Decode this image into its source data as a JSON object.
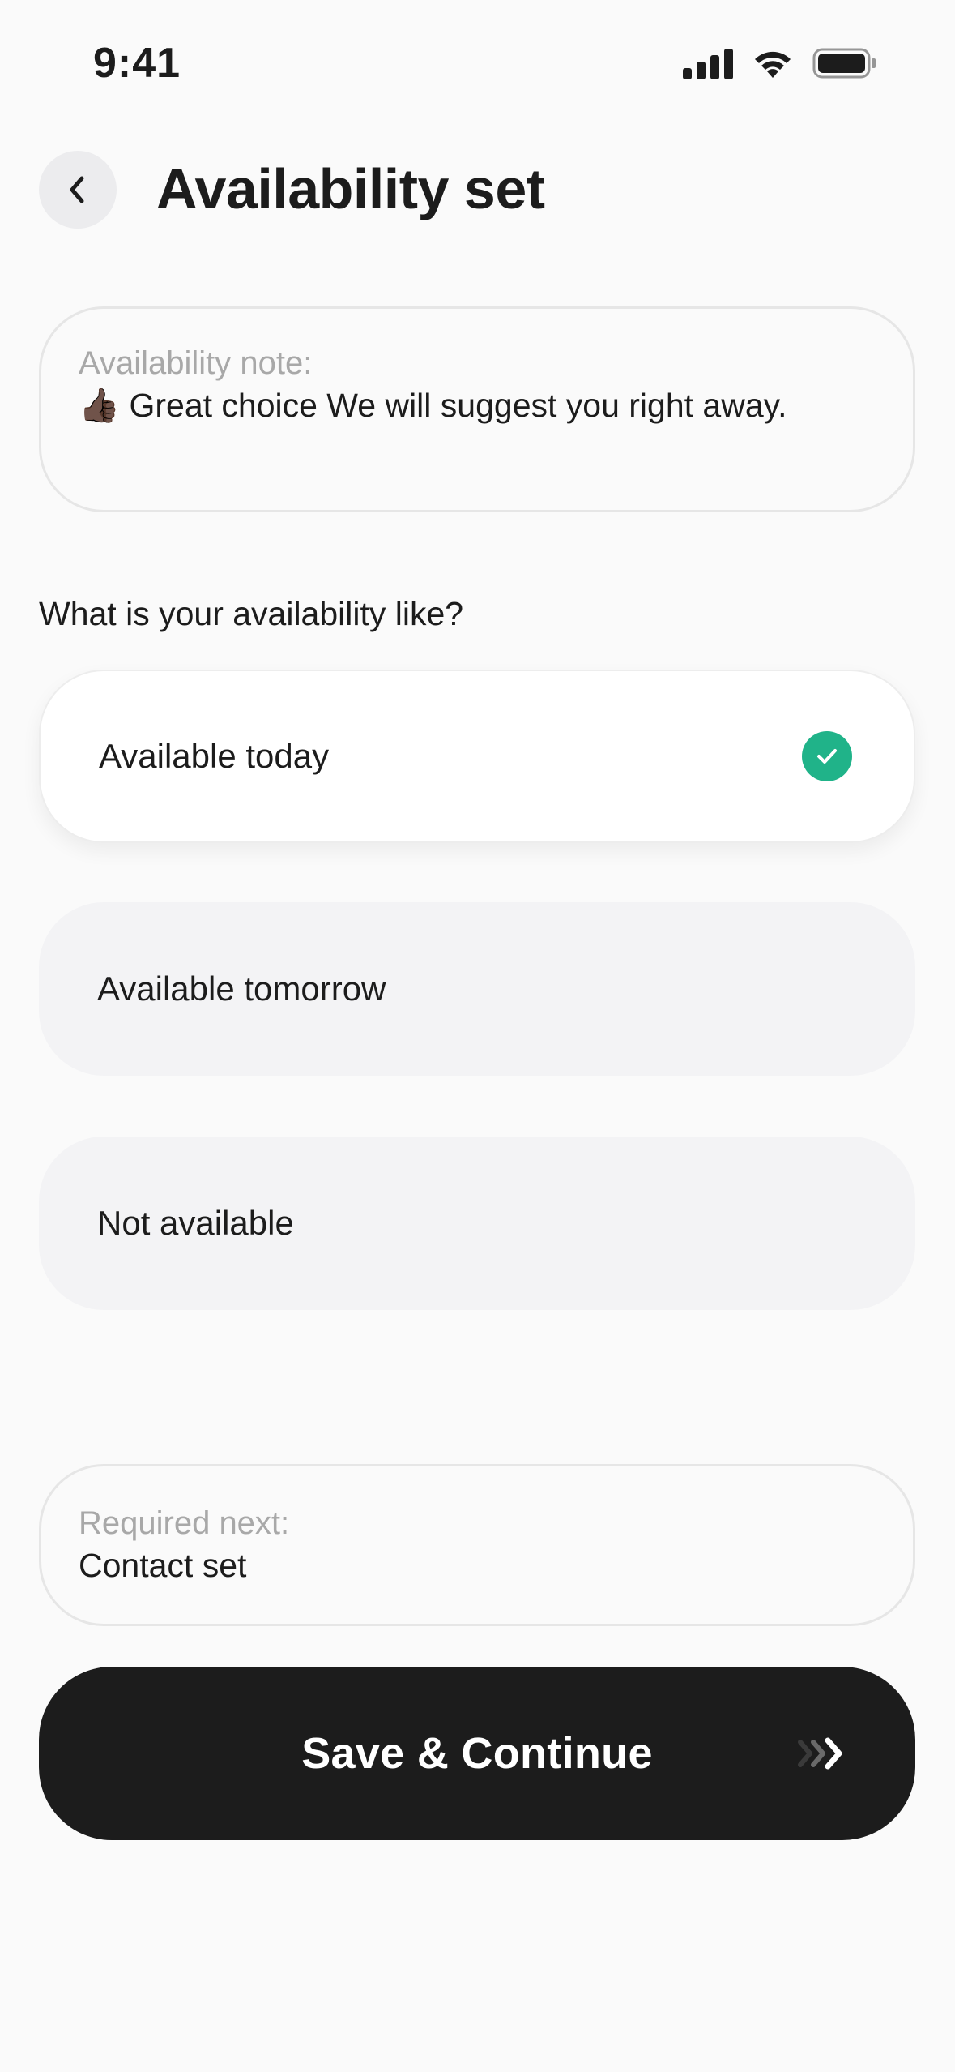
{
  "status_bar": {
    "time": "9:41",
    "icons": [
      "cellular-signal-icon",
      "wifi-icon",
      "battery-icon"
    ]
  },
  "header": {
    "back_icon": "chevron-left-icon",
    "title": "Availability set"
  },
  "note": {
    "label": "Availability note:",
    "emoji": "👍🏿",
    "text": "Great choice We will suggest you right away."
  },
  "question": "What is your availability like?",
  "options": [
    {
      "label": "Available today",
      "selected": true
    },
    {
      "label": "Available tomorrow",
      "selected": false
    },
    {
      "label": "Not available",
      "selected": false
    }
  ],
  "next": {
    "label": "Required next:",
    "value": "Contact set"
  },
  "cta": {
    "label": "Save & Continue",
    "icon": "double-chevron-right-icon"
  },
  "colors": {
    "background": "#fafafa",
    "text": "#1c1c1c",
    "muted": "#a8a8a8",
    "accent_check": "#20b389",
    "cta_bg": "#1c1c1c",
    "option_unselected": "#f3f3f5"
  }
}
